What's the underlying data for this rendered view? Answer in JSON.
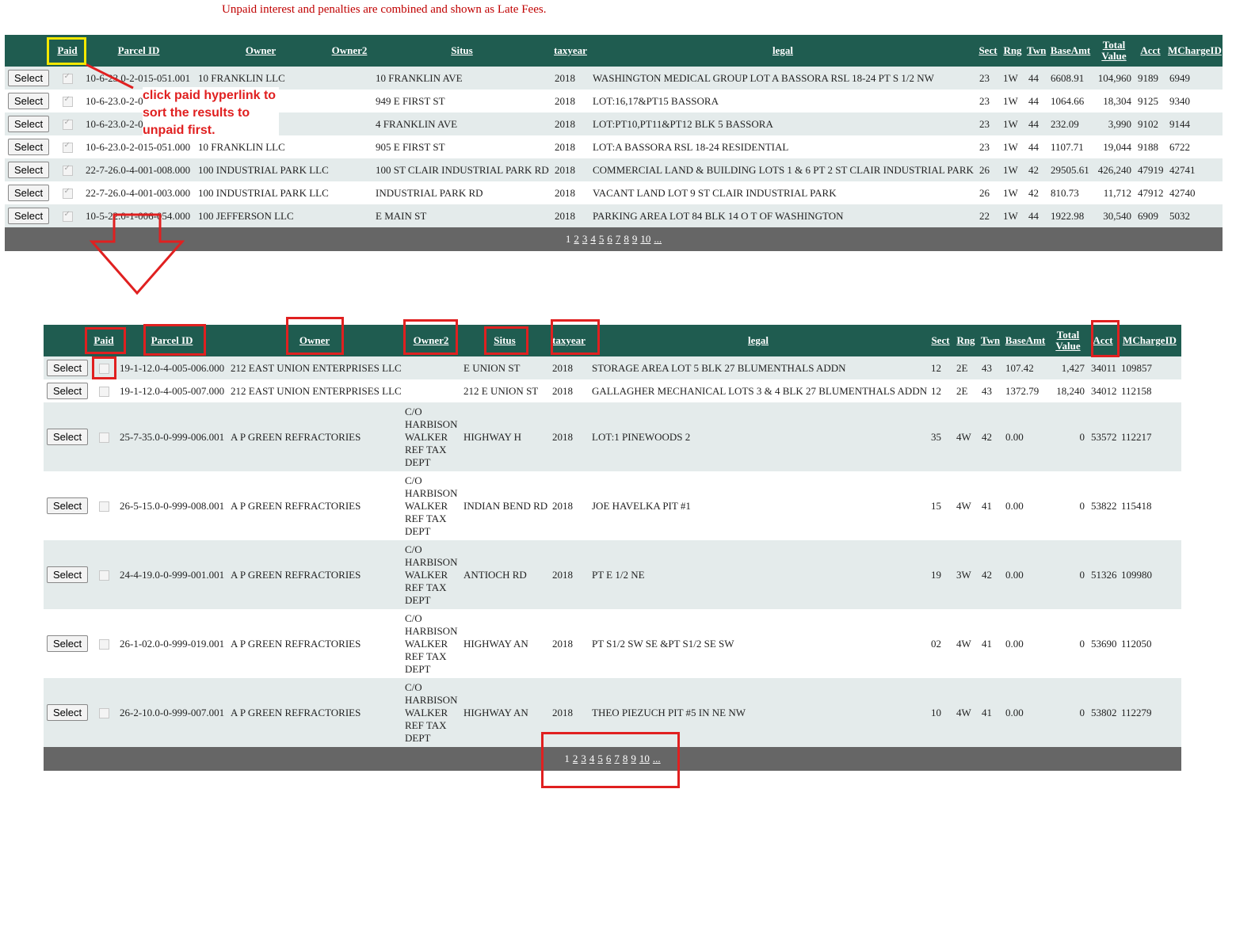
{
  "notice": "Unpaid interest and penalties are combined and shown as Late Fees.",
  "annotation": "click paid hyperlink to sort the results to unpaid first.",
  "select_label": "Select",
  "columns": {
    "paid": "Paid",
    "parcel": "Parcel ID",
    "owner": "Owner",
    "owner2": "Owner2",
    "situs": "Situs",
    "taxyear": "taxyear",
    "legal": "legal",
    "sect": "Sect",
    "rng": "Rng",
    "twn": "Twn",
    "baseamt": "BaseAmt",
    "total_value": "Total Value",
    "acct": "Acct",
    "mcharge": "MChargeID"
  },
  "pager": [
    "1",
    "2",
    "3",
    "4",
    "5",
    "6",
    "7",
    "8",
    "9",
    "10",
    "..."
  ],
  "table1": [
    {
      "paid": true,
      "parcel": "10-6-23.0-2-015-051.001",
      "owner": "10 FRANKLIN LLC",
      "owner2": "",
      "situs": "10 FRANKLIN AVE",
      "year": "2018",
      "legal": "WASHINGTON MEDICAL GROUP LOT A BASSORA RSL 18-24 PT S 1/2 NW",
      "sect": "23",
      "rng": "1W",
      "twn": "44",
      "base": "6608.91",
      "total": "104,960",
      "acct": "9189",
      "mcharge": "6949"
    },
    {
      "paid": true,
      "parcel": "10-6-23.0-2-0",
      "owner": "C",
      "owner2": "",
      "situs": "949 E FIRST ST",
      "year": "2018",
      "legal": "LOT:16,17&PT15 BASSORA",
      "sect": "23",
      "rng": "1W",
      "twn": "44",
      "base": "1064.66",
      "total": "18,304",
      "acct": "9125",
      "mcharge": "9340"
    },
    {
      "paid": true,
      "parcel": "10-6-23.0-2-0",
      "owner": "C",
      "owner2": "",
      "situs": "4 FRANKLIN AVE",
      "year": "2018",
      "legal": "LOT:PT10,PT11&PT12 BLK 5 BASSORA",
      "sect": "23",
      "rng": "1W",
      "twn": "44",
      "base": "232.09",
      "total": "3,990",
      "acct": "9102",
      "mcharge": "9144"
    },
    {
      "paid": true,
      "parcel": "10-6-23.0-2-015-051.000",
      "owner": "10 FRANKLIN LLC",
      "owner2": "",
      "situs": "905 E FIRST ST",
      "year": "2018",
      "legal": "LOT:A BASSORA RSL 18-24 RESIDENTIAL",
      "sect": "23",
      "rng": "1W",
      "twn": "44",
      "base": "1107.71",
      "total": "19,044",
      "acct": "9188",
      "mcharge": "6722"
    },
    {
      "paid": true,
      "parcel": "22-7-26.0-4-001-008.000",
      "owner": "100 INDUSTRIAL PARK LLC",
      "owner2": "",
      "situs": "100 ST CLAIR INDUSTRIAL PARK RD",
      "year": "2018",
      "legal": "COMMERCIAL LAND & BUILDING LOTS 1 & 6 PT 2 ST CLAIR INDUSTRIAL PARK",
      "sect": "26",
      "rng": "1W",
      "twn": "42",
      "base": "29505.61",
      "total": "426,240",
      "acct": "47919",
      "mcharge": "42741"
    },
    {
      "paid": true,
      "parcel": "22-7-26.0-4-001-003.000",
      "owner": "100 INDUSTRIAL PARK LLC",
      "owner2": "",
      "situs": "INDUSTRIAL PARK RD",
      "year": "2018",
      "legal": "VACANT LAND LOT 9 ST CLAIR INDUSTRIAL PARK",
      "sect": "26",
      "rng": "1W",
      "twn": "42",
      "base": "810.73",
      "total": "11,712",
      "acct": "47912",
      "mcharge": "42740"
    },
    {
      "paid": true,
      "parcel": "10-5-22.0-1-006-054.000",
      "owner": "100 JEFFERSON LLC",
      "owner2": "",
      "situs": "E MAIN ST",
      "year": "2018",
      "legal": "PARKING AREA LOT 84 BLK 14 O T OF WASHINGTON",
      "sect": "22",
      "rng": "1W",
      "twn": "44",
      "base": "1922.98",
      "total": "30,540",
      "acct": "6909",
      "mcharge": "5032"
    }
  ],
  "table2": [
    {
      "paid": false,
      "parcel": "19-1-12.0-4-005-006.000",
      "owner": "212 EAST UNION ENTERPRISES LLC",
      "owner2": "",
      "situs": "E UNION ST",
      "year": "2018",
      "legal": "STORAGE AREA LOT 5 BLK 27 BLUMENTHALS ADDN",
      "sect": "12",
      "rng": "2E",
      "twn": "43",
      "base": "107.42",
      "total": "1,427",
      "acct": "34011",
      "mcharge": "109857"
    },
    {
      "paid": false,
      "parcel": "19-1-12.0-4-005-007.000",
      "owner": "212 EAST UNION ENTERPRISES LLC",
      "owner2": "",
      "situs": "212 E UNION ST",
      "year": "2018",
      "legal": "GALLAGHER MECHANICAL LOTS 3 & 4 BLK 27 BLUMENTHALS ADDN",
      "sect": "12",
      "rng": "2E",
      "twn": "43",
      "base": "1372.79",
      "total": "18,240",
      "acct": "34012",
      "mcharge": "112158"
    },
    {
      "paid": false,
      "parcel": "25-7-35.0-0-999-006.001",
      "owner": "A P GREEN REFRACTORIES",
      "owner2": "C/O HARBISON WALKER REF TAX DEPT",
      "situs": "HIGHWAY H",
      "year": "2018",
      "legal": "LOT:1 PINEWOODS 2",
      "sect": "35",
      "rng": "4W",
      "twn": "42",
      "base": "0.00",
      "total": "0",
      "acct": "53572",
      "mcharge": "112217"
    },
    {
      "paid": false,
      "parcel": "26-5-15.0-0-999-008.001",
      "owner": "A P GREEN REFRACTORIES",
      "owner2": "C/O HARBISON WALKER REF TAX DEPT",
      "situs": "INDIAN BEND RD",
      "year": "2018",
      "legal": "JOE HAVELKA PIT #1",
      "sect": "15",
      "rng": "4W",
      "twn": "41",
      "base": "0.00",
      "total": "0",
      "acct": "53822",
      "mcharge": "115418"
    },
    {
      "paid": false,
      "parcel": "24-4-19.0-0-999-001.001",
      "owner": "A P GREEN REFRACTORIES",
      "owner2": "C/O HARBISON WALKER REF TAX DEPT",
      "situs": "ANTIOCH RD",
      "year": "2018",
      "legal": "PT E 1/2 NE",
      "sect": "19",
      "rng": "3W",
      "twn": "42",
      "base": "0.00",
      "total": "0",
      "acct": "51326",
      "mcharge": "109980"
    },
    {
      "paid": false,
      "parcel": "26-1-02.0-0-999-019.001",
      "owner": "A P GREEN REFRACTORIES",
      "owner2": "C/O HARBISON WALKER REF TAX DEPT",
      "situs": "HIGHWAY AN",
      "year": "2018",
      "legal": "PT S1/2 SW SE &PT S1/2 SE SW",
      "sect": "02",
      "rng": "4W",
      "twn": "41",
      "base": "0.00",
      "total": "0",
      "acct": "53690",
      "mcharge": "112050"
    },
    {
      "paid": false,
      "parcel": "26-2-10.0-0-999-007.001",
      "owner": "A P GREEN REFRACTORIES",
      "owner2": "C/O HARBISON WALKER REF TAX DEPT",
      "situs": "HIGHWAY AN",
      "year": "2018",
      "legal": "THEO PIEZUCH PIT #5 IN NE NW",
      "sect": "10",
      "rng": "4W",
      "twn": "41",
      "base": "0.00",
      "total": "0",
      "acct": "53802",
      "mcharge": "112279"
    }
  ]
}
